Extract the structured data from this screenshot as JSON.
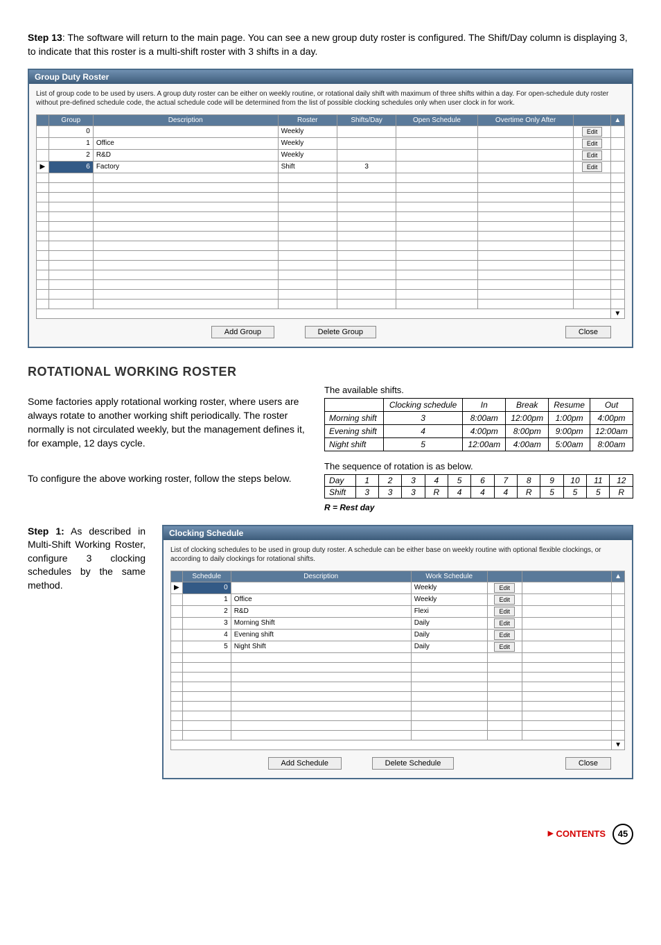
{
  "intro": {
    "step_label": "Step 13",
    "text": ": The software will return to the main page. You can see a new group duty roster is configured. The Shift/Day column is displaying 3, to indicate that this roster is a multi-shift roster with 3 shifts in a day."
  },
  "win1": {
    "title": "Group Duty Roster",
    "desc": "List of group code to be used by users. A group duty roster can be either on weekly routine, or rotational daily shift with maximum of three shifts within a day. For open-schedule duty roster without pre-defined schedule code, the actual schedule code will be determined from the list of possible clocking schedules only when user clock in for work.",
    "headers": [
      "",
      "Group",
      "Description",
      "Roster",
      "Shifts/Day",
      "Open Schedule",
      "Overtime Only After",
      ""
    ],
    "rows": [
      {
        "mark": "",
        "group": "0",
        "desc": "",
        "roster": "Weekly",
        "shifts": "",
        "open": "",
        "ot": "",
        "edit": "Edit",
        "sel": false
      },
      {
        "mark": "",
        "group": "1",
        "desc": "Office",
        "roster": "Weekly",
        "shifts": "",
        "open": "",
        "ot": "",
        "edit": "Edit",
        "sel": false
      },
      {
        "mark": "",
        "group": "2",
        "desc": "R&D",
        "roster": "Weekly",
        "shifts": "",
        "open": "",
        "ot": "",
        "edit": "Edit",
        "sel": false
      },
      {
        "mark": "▶",
        "group": "6",
        "desc": "Factory",
        "roster": "Shift",
        "shifts": "3",
        "open": "",
        "ot": "",
        "edit": "Edit",
        "sel": true
      }
    ],
    "buttons": {
      "add": "Add Group",
      "del": "Delete Group",
      "close": "Close"
    }
  },
  "section_heading": "ROTATIONAL WORKING ROSTER",
  "para_left_1": "Some factories apply rotational working roster, where users are always rotate to another working shift periodically. The roster normally is not circulated weekly, but the management defines it, for example, 12 days cycle.",
  "para_left_2": "To configure the above working roster, follow the steps below.",
  "avail_label": "The available shifts.",
  "shifts_table": {
    "headers": [
      "",
      "Clocking schedule",
      "In",
      "Break",
      "Resume",
      "Out"
    ],
    "rows": [
      [
        "Morning shift",
        "3",
        "8:00am",
        "12:00pm",
        "1:00pm",
        "4:00pm"
      ],
      [
        "Evening shift",
        "4",
        "4:00pm",
        "8:00pm",
        "9:00pm",
        "12:00am"
      ],
      [
        "Night shift",
        "5",
        "12:00am",
        "4:00am",
        "5:00am",
        "8:00am"
      ]
    ]
  },
  "seq_label": "The sequence of rotation is as below.",
  "seq_table": {
    "day_label": "Day",
    "days": [
      "1",
      "2",
      "3",
      "4",
      "5",
      "6",
      "7",
      "8",
      "9",
      "10",
      "11",
      "12"
    ],
    "shift_label": "Shift",
    "shifts": [
      "3",
      "3",
      "3",
      "R",
      "4",
      "4",
      "4",
      "R",
      "5",
      "5",
      "5",
      "R"
    ]
  },
  "rest_note": "R = Rest day",
  "step1": {
    "label": "Step 1:",
    "text": " As described in Multi-Shift Working Roster, configure 3 clocking schedules by the same method."
  },
  "win2": {
    "title": "Clocking Schedule",
    "desc": "List of clocking schedules to be used in group duty roster. A schedule can be either base on weekly routine with optional flexible clockings, or according to daily clockings for rotational shifts.",
    "headers": [
      "",
      "Schedule",
      "Description",
      "Work Schedule",
      "",
      ""
    ],
    "rows": [
      {
        "mark": "▶",
        "sched": "0",
        "desc": "",
        "ws": "Weekly",
        "edit": "Edit",
        "sel": true
      },
      {
        "mark": "",
        "sched": "1",
        "desc": "Office",
        "ws": "Weekly",
        "edit": "Edit",
        "sel": false
      },
      {
        "mark": "",
        "sched": "2",
        "desc": "R&D",
        "ws": "Flexi",
        "edit": "Edit",
        "sel": false
      },
      {
        "mark": "",
        "sched": "3",
        "desc": "Morning Shift",
        "ws": "Daily",
        "edit": "Edit",
        "sel": false
      },
      {
        "mark": "",
        "sched": "4",
        "desc": "Evening shift",
        "ws": "Daily",
        "edit": "Edit",
        "sel": false
      },
      {
        "mark": "",
        "sched": "5",
        "desc": "Night Shift",
        "ws": "Daily",
        "edit": "Edit",
        "sel": false
      }
    ],
    "buttons": {
      "add": "Add Schedule",
      "del": "Delete Schedule",
      "close": "Close"
    }
  },
  "footer": {
    "contents": "CONTENTS",
    "page": "45"
  }
}
